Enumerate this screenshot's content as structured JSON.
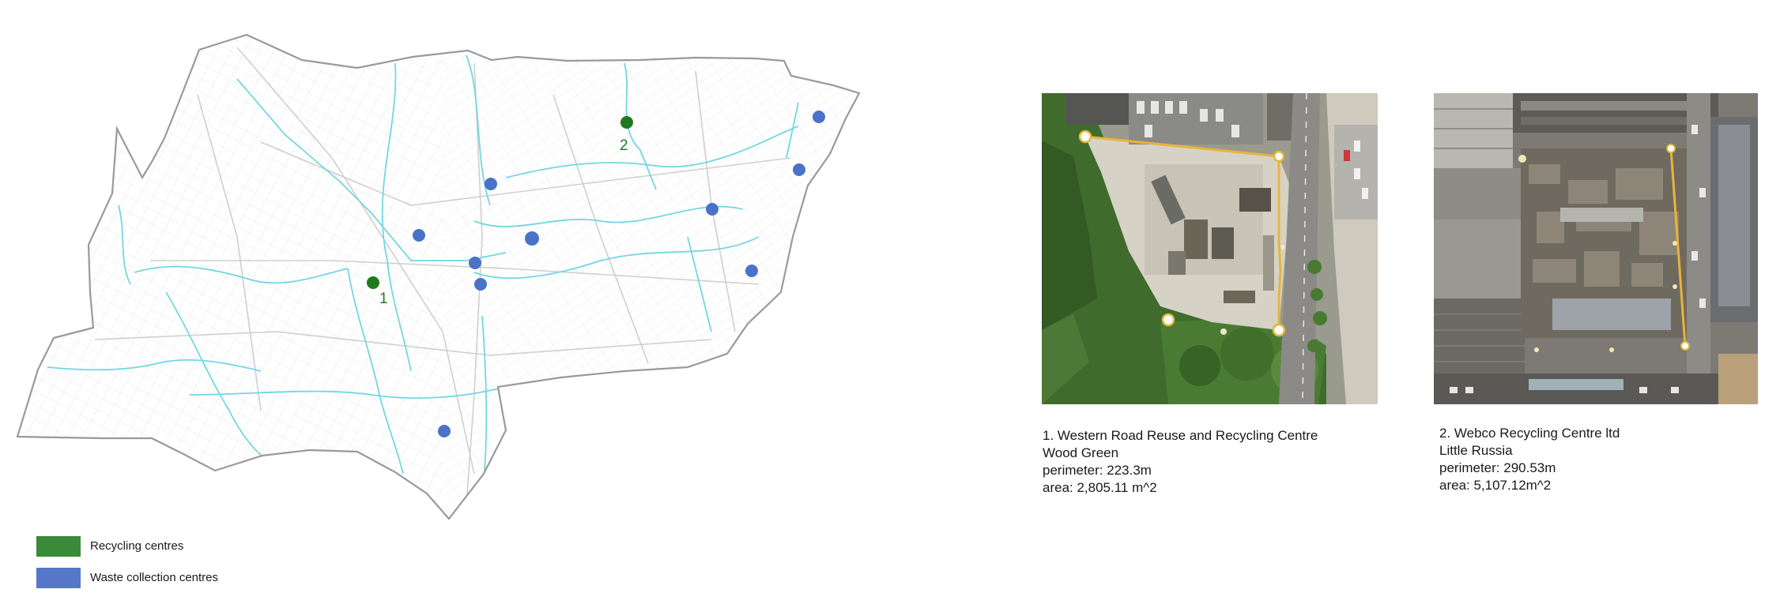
{
  "legend": {
    "items": [
      {
        "label": "Recycling centres",
        "color": "#3b8a3a"
      },
      {
        "label": "Waste collection centres",
        "color": "#5677c9"
      }
    ]
  },
  "map": {
    "boundary_color": "#9a9a9a",
    "street_color": "#d8d8d8",
    "river_color": "#6fd6e3",
    "recycling_color": "#1f7a1f",
    "waste_color": "#4a72c8",
    "recycling_labels": [
      "1",
      "2"
    ]
  },
  "sites": [
    {
      "title": "1. Western Road Reuse and Recycling Centre",
      "location": "Wood Green",
      "perimeter": "perimeter: 223.3m",
      "area": "area: 2,805.11 m^2"
    },
    {
      "title": "2. Webco Recycling Centre ltd",
      "location": "Little Russia",
      "perimeter": "perimeter: 290.53m",
      "area": "area: 5,107.12m^2"
    }
  ],
  "colors": {
    "outline_highlight": "#e8b43a"
  }
}
